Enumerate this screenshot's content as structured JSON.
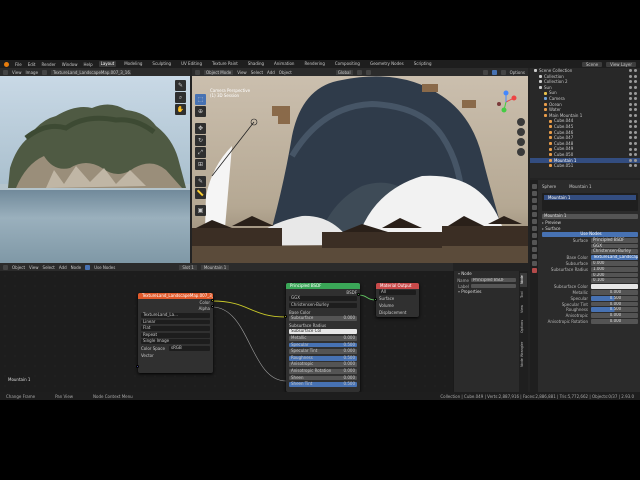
{
  "menus": [
    "File",
    "Edit",
    "Render",
    "Window",
    "Help"
  ],
  "workspaces": [
    "Layout",
    "Modeling",
    "Sculpting",
    "UV Editing",
    "Texture Paint",
    "Shading",
    "Animation",
    "Rendering",
    "Compositing",
    "Geometry Nodes",
    "Scripting"
  ],
  "scene": "Scene",
  "view_layer": "View Layer",
  "image_editor": {
    "header": [
      "View",
      "Image"
    ],
    "filename": "TextureLand_LandscapeMap.007_3_16.png"
  },
  "viewport": {
    "mode": "Object Mode",
    "header": [
      "View",
      "Select",
      "Add",
      "Object"
    ],
    "orientation": "Global",
    "options": "Options",
    "info": [
      "Camera Perspective",
      "(1) 3D Session"
    ]
  },
  "outliner": {
    "rows": [
      {
        "label": "Scene Collection",
        "color": "#cccccc",
        "indent": 0
      },
      {
        "label": "Collection",
        "color": "#cccccc",
        "indent": 1
      },
      {
        "label": "Collection 2",
        "color": "#cccccc",
        "indent": 1
      },
      {
        "label": "Sun",
        "color": "#cccccc",
        "indent": 1
      },
      {
        "label": "Sun",
        "color": "#e8c14a",
        "indent": 2
      },
      {
        "label": "Camera",
        "color": "#6fa1d8",
        "indent": 2
      },
      {
        "label": "Ocean",
        "color": "#e89c4a",
        "indent": 2
      },
      {
        "label": "Water",
        "color": "#e89c4a",
        "indent": 2
      },
      {
        "label": "Main Mountain 1",
        "color": "#e89c4a",
        "indent": 2
      },
      {
        "label": "Cube.044",
        "color": "#e89c4a",
        "indent": 3
      },
      {
        "label": "Cube.045",
        "color": "#e89c4a",
        "indent": 3
      },
      {
        "label": "Cube.046",
        "color": "#e89c4a",
        "indent": 3
      },
      {
        "label": "Cube.047",
        "color": "#e89c4a",
        "indent": 3
      },
      {
        "label": "Cube.048",
        "color": "#e89c4a",
        "indent": 3
      },
      {
        "label": "Cube.049",
        "color": "#e89c4a",
        "indent": 3
      },
      {
        "label": "Cube.050",
        "color": "#e89c4a",
        "indent": 3
      },
      {
        "label": "Mountain 1",
        "color": "#e89c4a",
        "indent": 3,
        "selected": true
      },
      {
        "label": "Cube.051",
        "color": "#e89c4a",
        "indent": 3
      }
    ]
  },
  "properties": {
    "object": "Sphere",
    "material_header": "Mountain 1",
    "slot": "Mountain 1",
    "material": "Mountain 1",
    "sections": [
      "Preview",
      "Surface"
    ],
    "use_nodes": "Use Nodes",
    "surface": "Principled BSDF",
    "distribution": "GGX",
    "subsurface_method": "Christensen-Burley",
    "rows": [
      {
        "label": "Base Color",
        "value": "TextureLand_LandscapeMap.007_3_16.png",
        "style": "blue"
      },
      {
        "label": "Subsurface",
        "value": "0.000",
        "style": "plain"
      },
      {
        "label": "Subsurface Radius",
        "value": "1.000",
        "style": "plain"
      },
      {
        "label": "",
        "value": "0.200",
        "style": "plain"
      },
      {
        "label": "",
        "value": "0.100",
        "style": "plain"
      },
      {
        "label": "Subsurface Color",
        "value": "",
        "style": "white"
      },
      {
        "label": "Metallic",
        "value": "0.000",
        "style": "slider",
        "fill": 0.0
      },
      {
        "label": "Specular",
        "value": "0.500",
        "style": "slider",
        "fill": 0.5
      },
      {
        "label": "Specular Tint",
        "value": "0.000",
        "style": "slider",
        "fill": 0.0
      },
      {
        "label": "Roughness",
        "value": "0.500",
        "style": "slider",
        "fill": 0.5
      },
      {
        "label": "Anisotropic",
        "value": "0.000",
        "style": "slider",
        "fill": 0.0
      },
      {
        "label": "Anisotropic Rotation",
        "value": "0.000",
        "style": "slider",
        "fill": 0.0
      }
    ]
  },
  "node_editor": {
    "header": [
      "Object",
      "View",
      "Select",
      "Add",
      "Node"
    ],
    "use_nodes": "Use Nodes",
    "slot": "Slot 1",
    "material": "Mountain 1",
    "frame_label": "Mountain 1",
    "image_node": {
      "title": "TextureLand_LandscapeMap.007_3_16.png",
      "outputs": [
        "Color",
        "Alpha"
      ],
      "image": "TextureLand_La...",
      "rows": [
        "Linear",
        "Flat",
        "Repeat",
        "Single Image"
      ],
      "color_space_label": "Color Space",
      "color_space": "sRGB",
      "input": "Vector"
    },
    "bsdf_node": {
      "title": "Principled BSDF",
      "output": "BSDF",
      "rows": [
        {
          "label": "GGX",
          "value": "",
          "kind": "dark"
        },
        {
          "label": "Christensen-Burley",
          "value": "",
          "kind": "dark"
        },
        {
          "label": "Base Color",
          "value": "",
          "kind": "label"
        },
        {
          "label": "Subsurface",
          "value": "0.000",
          "kind": "field"
        },
        {
          "label": "Subsurface Radius",
          "value": "",
          "kind": "label"
        },
        {
          "label": "Subsurface Col",
          "value": "",
          "kind": "white"
        },
        {
          "label": "Metallic",
          "value": "0.000",
          "kind": "field"
        },
        {
          "label": "Specular",
          "value": "0.500",
          "kind": "blue"
        },
        {
          "label": "Specular Tint",
          "value": "0.000",
          "kind": "field"
        },
        {
          "label": "Roughness",
          "value": "0.500",
          "kind": "blue"
        },
        {
          "label": "Anisotropic",
          "value": "0.000",
          "kind": "field"
        },
        {
          "label": "Anisotropic Rotation",
          "value": "0.000",
          "kind": "field"
        },
        {
          "label": "Sheen",
          "value": "0.000",
          "kind": "field"
        },
        {
          "label": "Sheen Tint",
          "value": "0.500",
          "kind": "blue"
        }
      ]
    },
    "output_node": {
      "title": "Material Output",
      "target": "All",
      "inputs": [
        "Surface",
        "Volume",
        "Displacement"
      ]
    }
  },
  "sidebar": {
    "section": "Node",
    "name_label": "Name",
    "name_value": "Principled BSDF",
    "label_label": "Label",
    "properties": "Properties",
    "tabs": [
      "Node",
      "Tool",
      "View",
      "Options",
      "Node Wrangler"
    ]
  },
  "status": {
    "left": "Change Frame",
    "mid": "Pan View",
    "right": "Node Context Menu",
    "stats": "Collection | Cube.049 | Verts:2,887,916 | Faces:2,886,881 | Tris:5,772,662 | Objects:0/37 | 2.93.0"
  },
  "colors": {
    "accent": "#4772b3",
    "image_node_header": "#e05a2b",
    "bsdf_header": "#3aa657",
    "output_header": "#c84a4a"
  }
}
